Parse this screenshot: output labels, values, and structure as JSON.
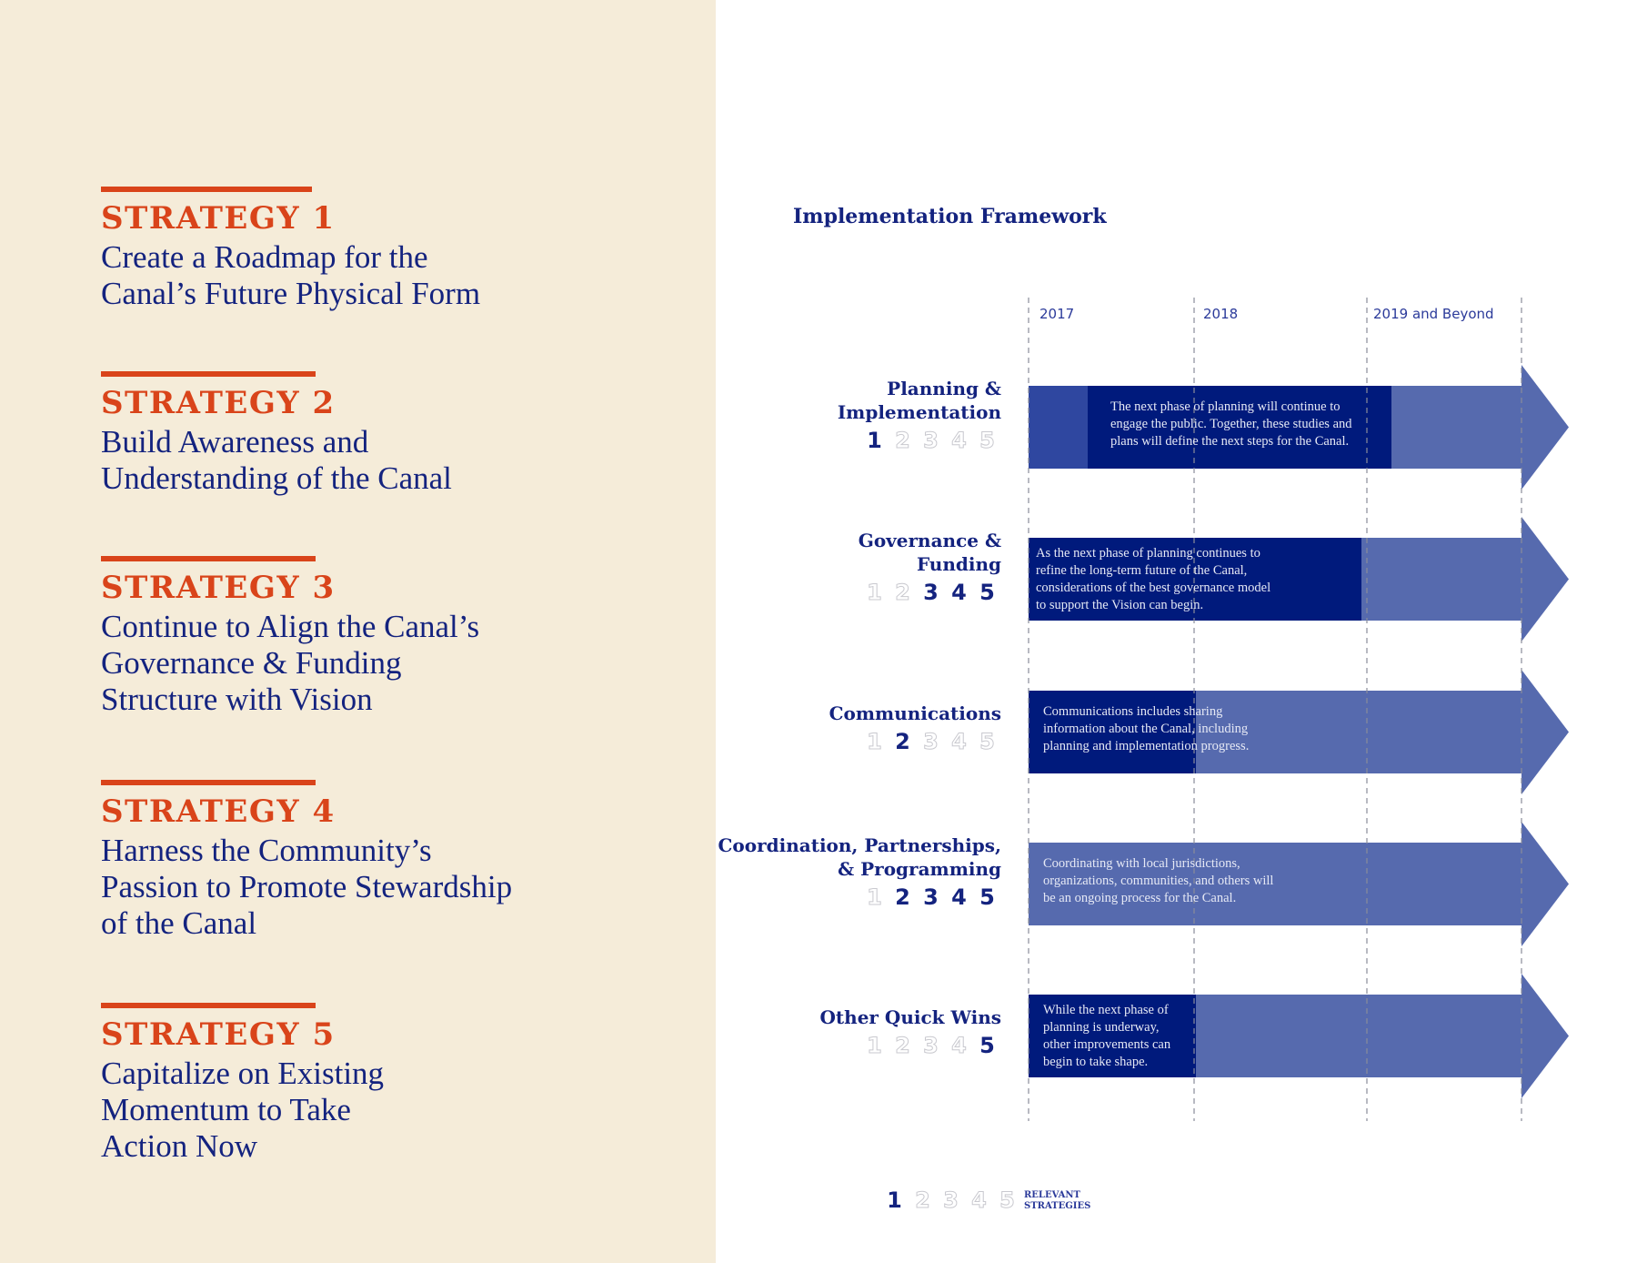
{
  "colors": {
    "left_background": "#f5ecd9",
    "accent_orange": "#d9441a",
    "navy": "#14237f",
    "dark_bar": "#001a7c",
    "mid_bar": "#2f47a0",
    "light_bar": "#566aae",
    "inactive_number_outline": "#c9c9cf"
  },
  "strategies": [
    {
      "kicker": "STRATEGY 1",
      "lines": [
        "Create a Roadmap for the",
        "Canal’s Future Physical Form"
      ]
    },
    {
      "kicker": "STRATEGY 2",
      "lines": [
        "Build Awareness and",
        "Understanding of the Canal"
      ]
    },
    {
      "kicker": "STRATEGY 3",
      "lines": [
        "Continue to Align the Canal’s",
        "Governance & Funding",
        "Structure with Vision"
      ]
    },
    {
      "kicker": "STRATEGY 4",
      "lines": [
        "Harness the Community’s",
        "Passion to Promote Stewardship",
        "of the Canal"
      ]
    },
    {
      "kicker": "STRATEGY 5",
      "lines": [
        "Capitalize on Existing",
        "Momentum to Take",
        "Action Now"
      ]
    }
  ],
  "framework": {
    "title": "Implementation Framework",
    "periods": [
      "2017",
      "2018",
      "2019 and Beyond"
    ],
    "rows": [
      {
        "label_lines": [
          "Planning &",
          "Implementation"
        ],
        "relevant": [
          1
        ],
        "description": [
          "The next phase of planning will continue to",
          "engage the public.  Together, these studies and",
          "plans will define the next steps for the Canal."
        ]
      },
      {
        "label_lines": [
          "Governance &",
          "Funding"
        ],
        "relevant": [
          3,
          4,
          5
        ],
        "description": [
          "As the next phase of planning continues to",
          "refine the long-term future of the Canal,",
          "considerations of the best governance model",
          "to support the Vision can begin."
        ]
      },
      {
        "label_lines": [
          "Communications"
        ],
        "relevant": [
          2
        ],
        "description": [
          "Communications includes sharing",
          "information about the Canal, including",
          "planning and implementation progress."
        ]
      },
      {
        "label_lines": [
          "Coordination, Partnerships,",
          "& Programming"
        ],
        "relevant": [
          2,
          3,
          4,
          5
        ],
        "description": [
          "Coordinating with local jurisdictions,",
          "organizations, communities, and others will",
          "be an ongoing process for the Canal."
        ]
      },
      {
        "label_lines": [
          "Other Quick Wins"
        ],
        "relevant": [
          5
        ],
        "description": [
          "While the next phase of",
          "planning is underway,",
          "other improvements can",
          "begin to take shape."
        ]
      }
    ],
    "legend": {
      "numbers": [
        "1",
        "2",
        "3",
        "4",
        "5"
      ],
      "highlighted": [
        1
      ],
      "label_lines": [
        "RELEVANT",
        "STRATEGIES"
      ]
    }
  }
}
